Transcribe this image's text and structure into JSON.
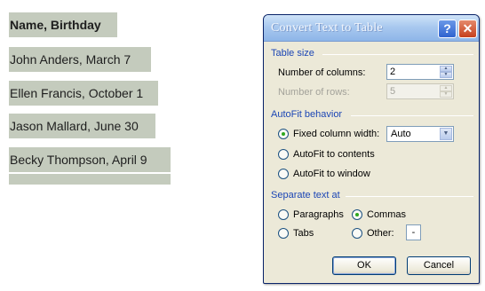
{
  "document": {
    "lines": [
      "Name, Birthday",
      "John Anders, March 7",
      "Ellen Francis, October 1",
      "Jason Mallard, June 30",
      "Becky Thompson, April 9"
    ]
  },
  "dialog": {
    "title": "Convert Text to Table",
    "help_button": "?",
    "close_button": "✕",
    "table_size": {
      "label": "Table size",
      "columns_label": "Number of columns:",
      "columns_value": "2",
      "rows_label": "Number of rows:",
      "rows_value": "5"
    },
    "autofit": {
      "label": "AutoFit behavior",
      "fixed_label": "Fixed column width:",
      "fixed_value": "Auto",
      "contents_label": "AutoFit to contents",
      "window_label": "AutoFit to window",
      "selected": "fixed"
    },
    "separate": {
      "label": "Separate text at",
      "paragraphs_label": "Paragraphs",
      "commas_label": "Commas",
      "tabs_label": "Tabs",
      "other_label": "Other:",
      "other_value": "-",
      "selected": "commas"
    },
    "ok_label": "OK",
    "cancel_label": "Cancel"
  }
}
